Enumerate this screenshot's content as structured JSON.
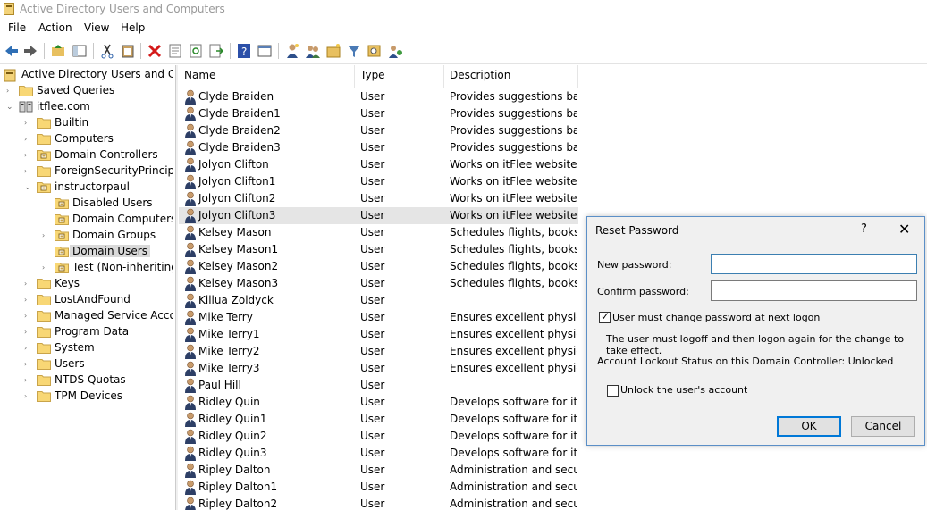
{
  "window": {
    "title": "Active Directory Users and Computers"
  },
  "menu": [
    "File",
    "Action",
    "View",
    "Help"
  ],
  "toolbar_icons": [
    "back-icon",
    "forward-icon",
    "up-folder-icon",
    "console-tree-icon",
    "cut-icon",
    "paste-icon",
    "delete-icon",
    "properties-icon",
    "refresh-icon",
    "export-list-icon",
    "help-icon",
    "view-icon",
    "new-user-icon",
    "new-group-icon",
    "new-ou-icon",
    "filter-icon",
    "find-icon",
    "add-to-group-icon"
  ],
  "tree": {
    "root": "Active Directory Users and Com",
    "items": [
      {
        "label": "Saved Queries"
      },
      {
        "label": "itflee.com"
      },
      {
        "label": "Builtin"
      },
      {
        "label": "Computers"
      },
      {
        "label": "Domain Controllers"
      },
      {
        "label": "ForeignSecurityPrincipals"
      },
      {
        "label": "instructorpaul"
      },
      {
        "label": "Disabled Users"
      },
      {
        "label": "Domain Computers"
      },
      {
        "label": "Domain Groups"
      },
      {
        "label": "Domain Users"
      },
      {
        "label": "Test (Non-inheriting)"
      },
      {
        "label": "Keys"
      },
      {
        "label": "LostAndFound"
      },
      {
        "label": "Managed Service Accoun"
      },
      {
        "label": "Program Data"
      },
      {
        "label": "System"
      },
      {
        "label": "Users"
      },
      {
        "label": "NTDS Quotas"
      },
      {
        "label": "TPM Devices"
      }
    ]
  },
  "list": {
    "columns": [
      "Name",
      "Type",
      "Description"
    ],
    "rows": [
      {
        "name": "Clyde Braiden",
        "type": "User",
        "desc": "Provides suggestions ba..."
      },
      {
        "name": "Clyde Braiden1",
        "type": "User",
        "desc": "Provides suggestions ba..."
      },
      {
        "name": "Clyde Braiden2",
        "type": "User",
        "desc": "Provides suggestions ba..."
      },
      {
        "name": "Clyde Braiden3",
        "type": "User",
        "desc": "Provides suggestions ba..."
      },
      {
        "name": "Jolyon Clifton",
        "type": "User",
        "desc": "Works on itFlee websites..."
      },
      {
        "name": "Jolyon Clifton1",
        "type": "User",
        "desc": "Works on itFlee websites..."
      },
      {
        "name": "Jolyon Clifton2",
        "type": "User",
        "desc": "Works on itFlee websites..."
      },
      {
        "name": "Jolyon Clifton3",
        "type": "User",
        "desc": "Works on itFlee websites..."
      },
      {
        "name": "Kelsey Mason",
        "type": "User",
        "desc": "Schedules flights, books..."
      },
      {
        "name": "Kelsey Mason1",
        "type": "User",
        "desc": "Schedules flights, books..."
      },
      {
        "name": "Kelsey Mason2",
        "type": "User",
        "desc": "Schedules flights, books..."
      },
      {
        "name": "Kelsey Mason3",
        "type": "User",
        "desc": "Schedules flights, books..."
      },
      {
        "name": "Killua Zoldyck",
        "type": "User",
        "desc": ""
      },
      {
        "name": "Mike Terry",
        "type": "User",
        "desc": "Ensures excellent physic..."
      },
      {
        "name": "Mike Terry1",
        "type": "User",
        "desc": "Ensures excellent physic..."
      },
      {
        "name": "Mike Terry2",
        "type": "User",
        "desc": "Ensures excellent physic..."
      },
      {
        "name": "Mike Terry3",
        "type": "User",
        "desc": "Ensures excellent physic..."
      },
      {
        "name": "Paul Hill",
        "type": "User",
        "desc": ""
      },
      {
        "name": "Ridley Quin",
        "type": "User",
        "desc": "Develops software for itf..."
      },
      {
        "name": "Ridley Quin1",
        "type": "User",
        "desc": "Develops software for itf..."
      },
      {
        "name": "Ridley Quin2",
        "type": "User",
        "desc": "Develops software for itf..."
      },
      {
        "name": "Ridley Quin3",
        "type": "User",
        "desc": "Develops software for itf..."
      },
      {
        "name": "Ripley Dalton",
        "type": "User",
        "desc": "Administration and secu..."
      },
      {
        "name": "Ripley Dalton1",
        "type": "User",
        "desc": "Administration and secu..."
      },
      {
        "name": "Ripley Dalton2",
        "type": "User",
        "desc": "Administration and secu..."
      }
    ]
  },
  "dialog": {
    "title": "Reset Password",
    "help": "?",
    "close": "✕",
    "new_password_label": "New password:",
    "new_password_value": "",
    "confirm_password_label": "Confirm password:",
    "confirm_password_value": "",
    "must_change_label": "User must change password at next logon",
    "must_change_checked": true,
    "info_text": "The user must logoff and then logon again for the change to take effect.",
    "lockout_text": "Account Lockout Status on this Domain Controller: Unlocked",
    "unlock_label": "Unlock the user's account",
    "unlock_checked": false,
    "ok_label": "OK",
    "cancel_label": "Cancel"
  }
}
